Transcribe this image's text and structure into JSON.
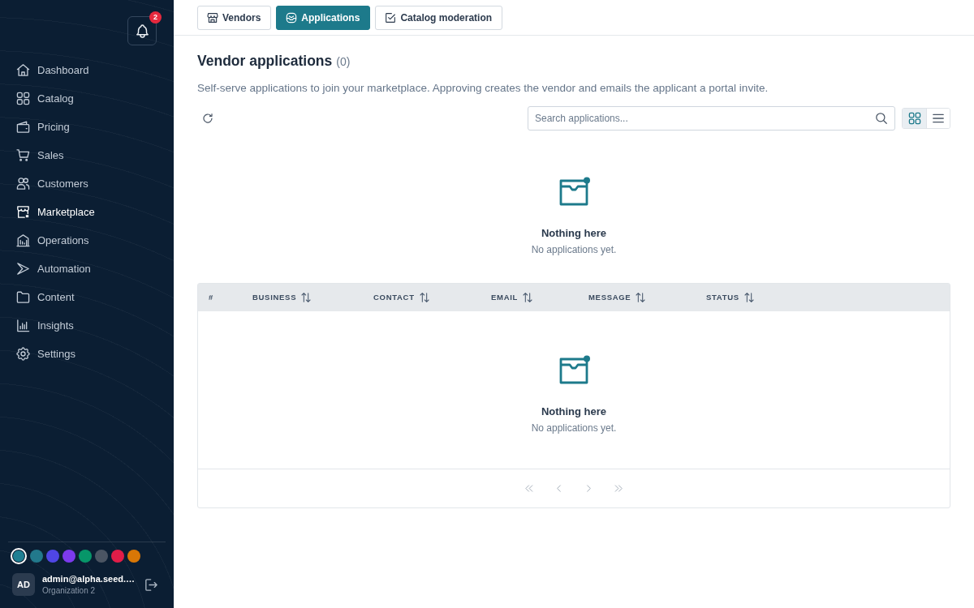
{
  "sidebar": {
    "notifications": {
      "count": "2"
    },
    "nav": [
      {
        "label": "Dashboard",
        "selected": false
      },
      {
        "label": "Catalog",
        "selected": false
      },
      {
        "label": "Pricing",
        "selected": false
      },
      {
        "label": "Sales",
        "selected": false
      },
      {
        "label": "Customers",
        "selected": false
      },
      {
        "label": "Marketplace",
        "selected": true
      },
      {
        "label": "Operations",
        "selected": false
      },
      {
        "label": "Automation",
        "selected": false
      },
      {
        "label": "Content",
        "selected": false
      },
      {
        "label": "Insights",
        "selected": false
      },
      {
        "label": "Settings",
        "selected": false
      }
    ],
    "themes": [
      {
        "color": "#1f7f93",
        "selected": true
      },
      {
        "color": "#22798c",
        "selected": false
      },
      {
        "color": "#4f46e5",
        "selected": false
      },
      {
        "color": "#7c3aed",
        "selected": false
      },
      {
        "color": "#079669",
        "selected": false
      },
      {
        "color": "#4b5563",
        "selected": false
      },
      {
        "color": "#e11d48",
        "selected": false
      },
      {
        "color": "#d97706",
        "selected": false
      }
    ],
    "user": {
      "initials": "AD",
      "email": "admin@alpha.seed.…",
      "organization": "Organization 2"
    }
  },
  "tabs": [
    {
      "label": "Vendors",
      "selected": false
    },
    {
      "label": "Applications",
      "selected": true
    },
    {
      "label": "Catalog moderation",
      "selected": false
    }
  ],
  "page": {
    "title": "Vendor applications",
    "count": "(0)",
    "description": "Self-serve applications to join your marketplace. Approving creates the vendor and emails the applicant a portal invite."
  },
  "toolbar": {
    "search": {
      "placeholder": "Search applications..."
    },
    "view_toggle": [
      {
        "kind": "grid",
        "selected": true
      },
      {
        "kind": "list",
        "selected": false
      }
    ]
  },
  "empty_state": {
    "title": "Nothing here",
    "message": "No applications yet."
  },
  "table": {
    "columns": [
      "#",
      "BUSINESS",
      "CONTACT",
      "EMAIL",
      "MESSAGE",
      "STATUS"
    ],
    "empty_state": {
      "title": "Nothing here",
      "message": "No applications yet."
    },
    "pagination": [
      {
        "kind": "first",
        "disabled": true
      },
      {
        "kind": "previous",
        "disabled": true
      },
      {
        "kind": "next",
        "disabled": true
      },
      {
        "kind": "last",
        "disabled": true
      }
    ]
  }
}
